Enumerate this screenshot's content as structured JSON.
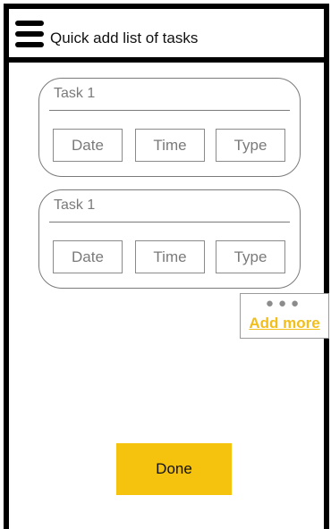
{
  "header": {
    "title": "Quick add list of tasks",
    "menu_icon": "hamburger-menu-icon"
  },
  "tasks": [
    {
      "name": "Task 1",
      "fields": {
        "date": "Date",
        "time": "Time",
        "type": "Type"
      }
    },
    {
      "name": "Task 1",
      "fields": {
        "date": "Date",
        "time": "Time",
        "type": "Type"
      }
    }
  ],
  "add_more": {
    "icon": "more-dots-icon",
    "dots": "●●●",
    "label": "Add more"
  },
  "done": {
    "label": "Done"
  },
  "colors": {
    "accent": "#f5c20d",
    "link": "#f2be1a",
    "border": "#7a7a7a",
    "frame": "#000000"
  }
}
